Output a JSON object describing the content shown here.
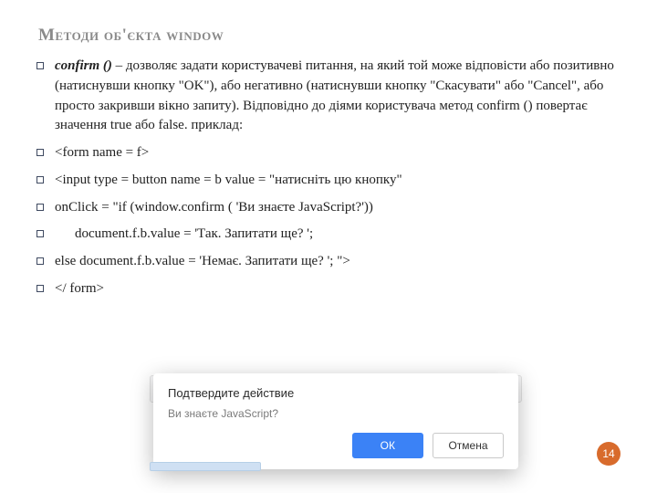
{
  "title": "Методи об'єкта window",
  "bullets": {
    "b0_kw": "confirm ()",
    "b0_rest": " – дозволяє задати користувачеві питання, на який той може відповісти або позитивно (натиснувши кнопку \"OK\"), або негативно (натиснувши кнопку \"Скасувати\" або \"Cancel\", або просто закривши вікно запиту). Відповідно до діями користувача метод confirm () повертає значення true або false. приклад:",
    "b1": "<form name = f>",
    "b2": "<input type = button name = b value = \"натисніть цю кнопку\"",
    "b3": "onClick = \"if (window.confirm ( 'Ви знаєте JavaScript?'))",
    "b4": "document.f.b.value = 'Так. Запитати ще? ';",
    "b5": "else document.f.b.value = 'Немає. Запитати ще? '; \">",
    "b6": "</ form>"
  },
  "dialog": {
    "title": "Подтвердите действие",
    "message": "Ви знаєте JavaScript?",
    "ok": "ОК",
    "cancel": "Отмена"
  },
  "page_number": "14"
}
